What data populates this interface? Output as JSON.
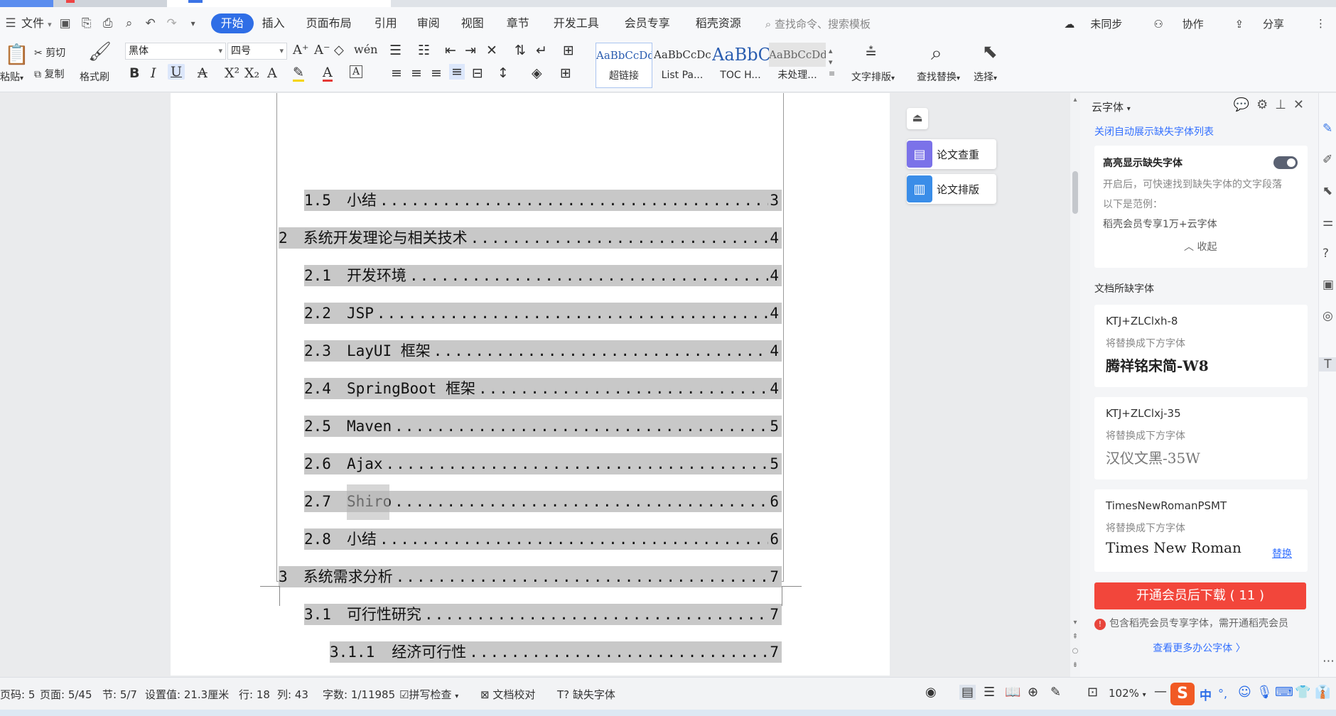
{
  "menubar": {
    "file": "文件",
    "tabs": [
      "开始",
      "插入",
      "页面布局",
      "引用",
      "审阅",
      "视图",
      "章节",
      "开发工具",
      "会员专享",
      "稻壳资源"
    ],
    "search_placeholder": "查找命令、搜索模板",
    "sync": "未同步",
    "collab": "协作",
    "share": "分享"
  },
  "ribbon": {
    "paste": "粘贴",
    "cut": "剪切",
    "copy": "复制",
    "format_painter": "格式刷",
    "font_name": "黑体",
    "font_size": "四号",
    "styles": [
      {
        "preview": "AaBbCcDd",
        "label": "超链接"
      },
      {
        "preview": "AaBbCcDc",
        "label": "List Pa..."
      },
      {
        "preview": "AaBbC",
        "label": "TOC H..."
      },
      {
        "preview": "AaBbCcDd",
        "label": "未处理..."
      }
    ],
    "text_layout": "文字排版",
    "find_replace": "查找替换",
    "select": "选择"
  },
  "toc": [
    {
      "num": "1.5",
      "title": "小结",
      "page": "3",
      "level": 2
    },
    {
      "num": "2",
      "title": "系统开发理论与相关技术",
      "page": "4",
      "level": 1
    },
    {
      "num": "2.1",
      "title": "开发环境",
      "page": "4",
      "level": 2
    },
    {
      "num": "2.2",
      "title": "JSP",
      "page": "4",
      "level": 2
    },
    {
      "num": "2.3",
      "title": " LayUI 框架",
      "page": "4",
      "level": 2
    },
    {
      "num": "2.4",
      "title": "SpringBoot 框架",
      "page": "4",
      "level": 2
    },
    {
      "num": "2.5",
      "title": "Maven",
      "page": "5",
      "level": 2
    },
    {
      "num": "2.6",
      "title": "Ajax",
      "page": "5",
      "level": 2
    },
    {
      "num": "2.7",
      "title": "Shiro",
      "page": "6",
      "level": 2
    },
    {
      "num": "2.8",
      "title": "小结",
      "page": "6",
      "level": 2
    },
    {
      "num": "3",
      "title": "系统需求分析",
      "page": "7",
      "level": 1
    },
    {
      "num": "3.1",
      "title": "可行性研究",
      "page": "7",
      "level": 2
    },
    {
      "num": "3.1.1",
      "title": "经济可行性",
      "page": "7",
      "level": 3
    }
  ],
  "floating": {
    "plagiarism_check": "论文查重",
    "thesis_format": "论文排版"
  },
  "panel": {
    "title": "云字体",
    "close_auto_link": "关闭自动展示缺失字体列表",
    "highlight_title": "高亮显示缺失字体",
    "highlight_desc": "开启后，可快速找到缺失字体的文字段落",
    "example_label": "以下是范例：",
    "example_text": "稻壳会员专享1万+云字体",
    "collapse": "收起",
    "missing_section": "文档所缺字体",
    "fonts": [
      {
        "name": "KTJ+ZLClxh-8",
        "replace_label": "将替换成下方字体",
        "target": "腾祥铭宋简-W8",
        "action": ""
      },
      {
        "name": "KTJ+ZLClxj-35",
        "replace_label": "将替换成下方字体",
        "target": "汉仪文黑-35W",
        "action": ""
      },
      {
        "name": "TimesNewRomanPSMT",
        "replace_label": "将替换成下方字体",
        "target": "Times New Roman",
        "action": "替换"
      }
    ],
    "vip_button": "开通会员后下载 ( 11 )",
    "vip_note": "包含稻壳会员专享字体，需开通稻壳会员",
    "more_link": "查看更多办公字体 〉"
  },
  "statusbar": {
    "page_code": "页码: 5",
    "page": "页面: 5/45",
    "section": "节: 5/7",
    "setting": "设置值: 21.3厘米",
    "row": "行: 18",
    "col": "列: 43",
    "word_count": "字数: 1/11985",
    "spell_check": "拼写检查",
    "proofread": "文档校对",
    "missing_fonts": "缺失字体",
    "zoom": "102%",
    "ime_lang": "中"
  }
}
